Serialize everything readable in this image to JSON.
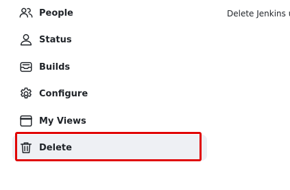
{
  "sidebar": {
    "items": [
      {
        "label": "People",
        "icon": "people-icon"
      },
      {
        "label": "Status",
        "icon": "user-icon"
      },
      {
        "label": "Builds",
        "icon": "inbox-icon"
      },
      {
        "label": "Configure",
        "icon": "gear-icon"
      },
      {
        "label": "My Views",
        "icon": "window-icon"
      },
      {
        "label": "Delete",
        "icon": "trash-icon",
        "active": true
      }
    ]
  },
  "main": {
    "text": "Delete Jenkins u"
  },
  "colors": {
    "highlight": "#e00000",
    "active_bg": "#eef0f4"
  }
}
